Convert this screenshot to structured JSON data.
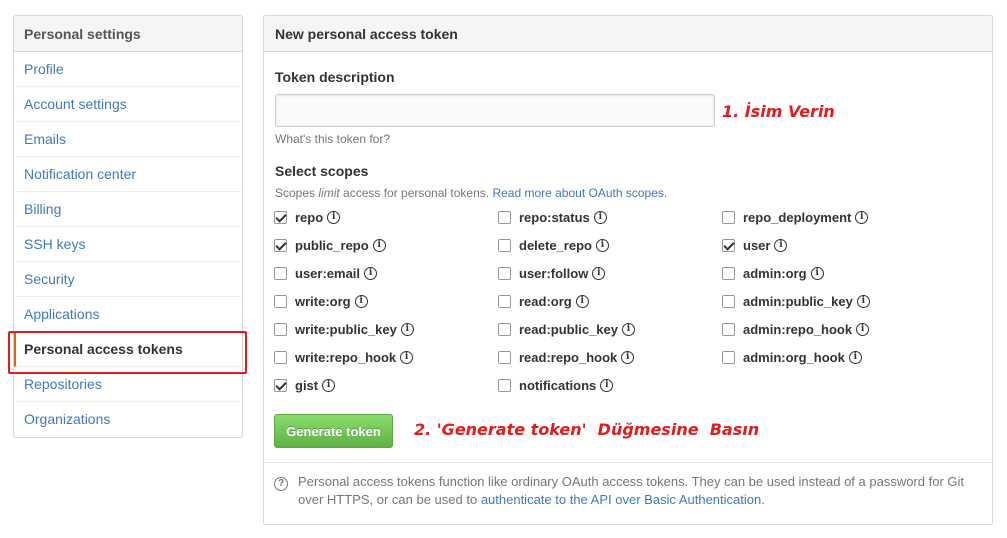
{
  "sidebar": {
    "title": "Personal settings",
    "items": [
      {
        "label": "Profile"
      },
      {
        "label": "Account settings"
      },
      {
        "label": "Emails"
      },
      {
        "label": "Notification center"
      },
      {
        "label": "Billing"
      },
      {
        "label": "SSH keys"
      },
      {
        "label": "Security"
      },
      {
        "label": "Applications"
      },
      {
        "label": "Personal access tokens",
        "selected": true
      },
      {
        "label": "Repositories"
      },
      {
        "label": "Organizations"
      }
    ]
  },
  "panel": {
    "title": "New personal access token",
    "description_label": "Token description",
    "description_value": "",
    "description_hint": "What's this token for?",
    "scopes_label": "Select scopes",
    "scopes_note_prefix": "Scopes ",
    "scopes_note_em": "limit",
    "scopes_note_suffix": " access for personal tokens. ",
    "scopes_note_link": "Read more about OAuth scopes.",
    "scopes": [
      {
        "name": "repo",
        "checked": true
      },
      {
        "name": "repo:status",
        "checked": false
      },
      {
        "name": "repo_deployment",
        "checked": false
      },
      {
        "name": "public_repo",
        "checked": true
      },
      {
        "name": "delete_repo",
        "checked": false
      },
      {
        "name": "user",
        "checked": true
      },
      {
        "name": "user:email",
        "checked": false
      },
      {
        "name": "user:follow",
        "checked": false
      },
      {
        "name": "admin:org",
        "checked": false
      },
      {
        "name": "write:org",
        "checked": false
      },
      {
        "name": "read:org",
        "checked": false
      },
      {
        "name": "admin:public_key",
        "checked": false
      },
      {
        "name": "write:public_key",
        "checked": false
      },
      {
        "name": "read:public_key",
        "checked": false
      },
      {
        "name": "admin:repo_hook",
        "checked": false
      },
      {
        "name": "write:repo_hook",
        "checked": false
      },
      {
        "name": "read:repo_hook",
        "checked": false
      },
      {
        "name": "admin:org_hook",
        "checked": false
      },
      {
        "name": "gist",
        "checked": true
      },
      {
        "name": "notifications",
        "checked": false
      }
    ],
    "generate_button": "Generate token",
    "footer_text": "Personal access tokens function like ordinary OAuth access tokens. They can be used instead of a password for Git over HTTPS, or can be used to ",
    "footer_link": "authenticate to the API over Basic Authentication",
    "footer_end": "."
  },
  "annotations": {
    "step1": "1. İsim Verin",
    "step2": "2. 'Generate token'  Düğmesine  Basın",
    "color": "#e21c1c"
  },
  "icons": {
    "info": "info-icon",
    "help": "question-icon"
  }
}
